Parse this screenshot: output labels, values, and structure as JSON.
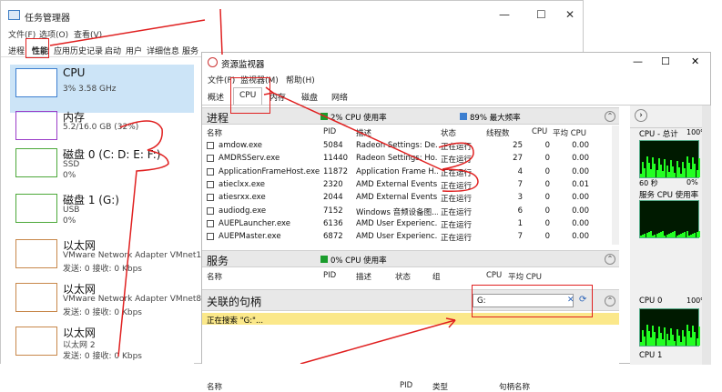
{
  "task_manager": {
    "title": "任务管理器",
    "menu": [
      "文件(F)",
      "选项(O)",
      "查看(V)"
    ],
    "tabs": [
      "进程",
      "性能",
      "应用历史记录",
      "启动",
      "用户",
      "详细信息",
      "服务"
    ],
    "items": [
      {
        "name": "CPU",
        "l1": "3% 3.58 GHz",
        "l2": ""
      },
      {
        "name": "内存",
        "l1": "5.2/16.0 GB (32%)",
        "l2": ""
      },
      {
        "name": "磁盘 0 (C: D: E: F:)",
        "l1": "SSD",
        "l2": "0%"
      },
      {
        "name": "磁盘 1 (G:)",
        "l1": "USB",
        "l2": "0%"
      },
      {
        "name": "以太网",
        "l1": "VMware Network Adapter VMnet1",
        "l2": "发送: 0 接收: 0 Kbps"
      },
      {
        "name": "以太网",
        "l1": "VMware Network Adapter VMnet8",
        "l2": "发送: 0 接收: 0 Kbps"
      },
      {
        "name": "以太网",
        "l1": "以太网 2",
        "l2": "发送: 0 接收: 0 Kbps"
      }
    ]
  },
  "resmon": {
    "title": "资源监视器",
    "menu": [
      "文件(F)",
      "监视器(M)",
      "帮助(H)"
    ],
    "tabs": [
      "概述",
      "CPU",
      "内存",
      "磁盘",
      "网络"
    ],
    "process": {
      "title": "进程",
      "stat1": "2% CPU 使用率",
      "stat2": "89% 最大频率",
      "cols": [
        "名称",
        "PID",
        "描述",
        "状态",
        "线程数",
        "CPU",
        "平均 CPU"
      ],
      "rows": [
        [
          "amdow.exe",
          "5084",
          "Radeon Settings: De...",
          "正在运行",
          "25",
          "0",
          "0.00"
        ],
        [
          "AMDRSServ.exe",
          "11440",
          "Radeon Settings: Ho...",
          "正在运行",
          "27",
          "0",
          "0.00"
        ],
        [
          "ApplicationFrameHost.exe",
          "11872",
          "Application Frame H...",
          "正在运行",
          "4",
          "0",
          "0.00"
        ],
        [
          "atieclxx.exe",
          "2320",
          "AMD External Events ...",
          "正在运行",
          "7",
          "0",
          "0.01"
        ],
        [
          "atiesrxx.exe",
          "2044",
          "AMD External Events ...",
          "正在运行",
          "3",
          "0",
          "0.00"
        ],
        [
          "audiodg.exe",
          "7152",
          "Windows 音频设备图...",
          "正在运行",
          "6",
          "0",
          "0.00"
        ],
        [
          "AUEPLauncher.exe",
          "6136",
          "AMD User Experienc...",
          "正在运行",
          "1",
          "0",
          "0.00"
        ],
        [
          "AUEPMaster.exe",
          "6872",
          "AMD User Experienc...",
          "正在运行",
          "7",
          "0",
          "0.00"
        ]
      ]
    },
    "services": {
      "title": "服务",
      "stat": "0% CPU 使用率",
      "cols": [
        "名称",
        "PID",
        "描述",
        "状态",
        "组",
        "CPU",
        "平均 CPU"
      ]
    },
    "handles": {
      "title": "关联的句柄",
      "search_value": "G:",
      "searching": "正在搜索 \"G:\"...",
      "cols": [
        "名称",
        "PID",
        "类型",
        "句柄名称"
      ]
    },
    "graphs": [
      "CPU - 总计",
      "60 秒",
      "服务 CPU 使用率",
      "CPU 0",
      "CPU 1"
    ],
    "graph_values": [
      "100%",
      "0%",
      "100%"
    ]
  },
  "colors": {
    "green": "#1a9c2c",
    "blue": "#3d7fd0",
    "annot": "#e02020"
  }
}
